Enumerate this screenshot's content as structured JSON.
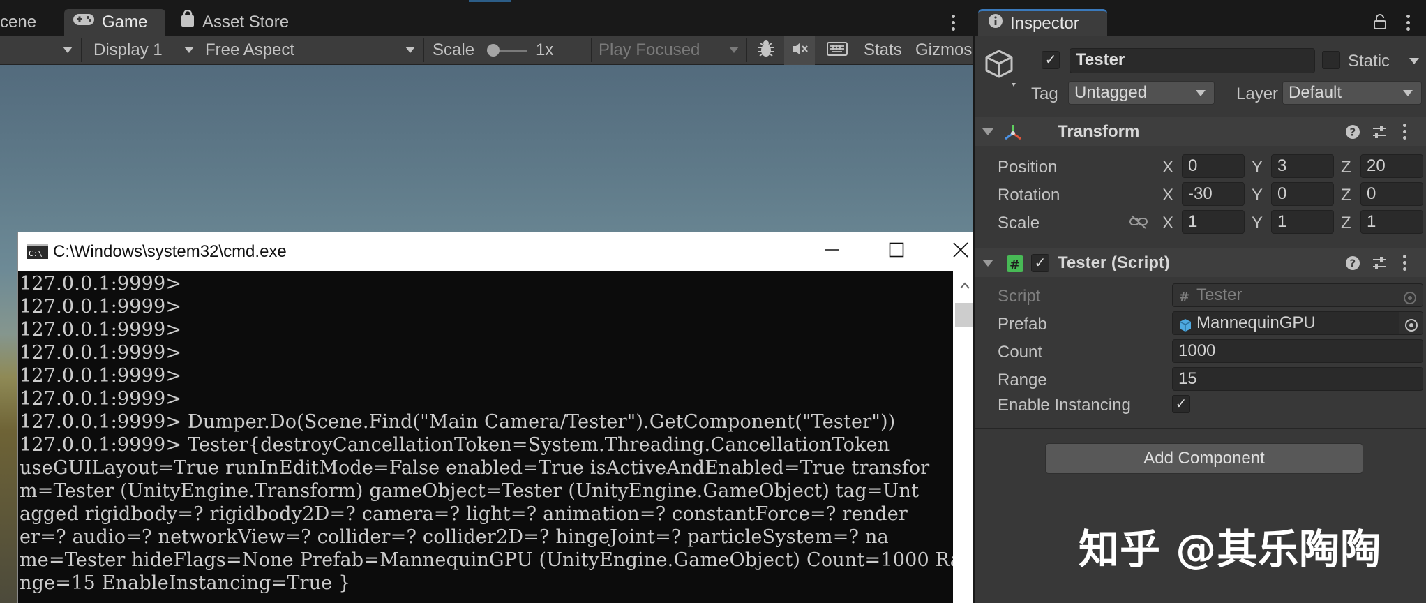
{
  "game": {
    "tabs": [
      {
        "label": "cene",
        "icon": "scene-icon"
      },
      {
        "label": "Game",
        "icon": "gamepad-icon"
      },
      {
        "label": "Asset Store",
        "icon": "shopping-bag-icon"
      }
    ],
    "toolbar": {
      "display": "Display 1",
      "aspect": "Free Aspect",
      "scale_label": "Scale",
      "scale_value": "1x",
      "play_mode": "Play Focused",
      "stats": "Stats",
      "gizmos": "Gizmos"
    }
  },
  "cmd": {
    "title": "C:\\Windows\\system32\\cmd.exe",
    "lines": [
      "127.0.0.1:9999>",
      "127.0.0.1:9999>",
      "127.0.0.1:9999>",
      "127.0.0.1:9999>",
      "127.0.0.1:9999>",
      "127.0.0.1:9999>",
      "127.0.0.1:9999> Dumper.Do(Scene.Find(\"Main Camera/Tester\").GetComponent(\"Tester\"))",
      "127.0.0.1:9999> Tester{destroyCancellationToken=System.Threading.CancellationToken",
      "useGUILayout=True runInEditMode=False enabled=True isActiveAndEnabled=True transfor",
      "m=Tester (UnityEngine.Transform) gameObject=Tester (UnityEngine.GameObject) tag=Unt",
      "agged rigidbody=? rigidbody2D=? camera=? light=? animation=? constantForce=? render",
      "er=? audio=? networkView=? collider=? collider2D=? hingeJoint=? particleSystem=? na",
      "me=Tester hideFlags=None Prefab=MannequinGPU (UnityEngine.GameObject) Count=1000 Ra",
      "nge=15 EnableInstancing=True }"
    ]
  },
  "inspector": {
    "tab_label": "Inspector",
    "object": {
      "name": "Tester",
      "active": true,
      "static_label": "Static",
      "tag_label": "Tag",
      "tag_value": "Untagged",
      "layer_label": "Layer",
      "layer_value": "Default"
    },
    "transform": {
      "title": "Transform",
      "rows": [
        {
          "label": "Position",
          "x": "0",
          "y": "3",
          "z": "20"
        },
        {
          "label": "Rotation",
          "x": "-30",
          "y": "0",
          "z": "0"
        },
        {
          "label": "Scale",
          "x": "1",
          "y": "1",
          "z": "1"
        }
      ],
      "axis": {
        "x": "X",
        "y": "Y",
        "z": "Z"
      }
    },
    "script_component": {
      "title": "Tester (Script)",
      "enabled": true,
      "script_label": "Script",
      "script_value": "Tester",
      "prefab_label": "Prefab",
      "prefab_value": "MannequinGPU",
      "count_label": "Count",
      "count_value": "1000",
      "range_label": "Range",
      "range_value": "15",
      "instancing_label": "Enable Instancing",
      "instancing_value": true
    },
    "add_component": "Add Component"
  },
  "watermark": "知乎 @其乐陶陶"
}
